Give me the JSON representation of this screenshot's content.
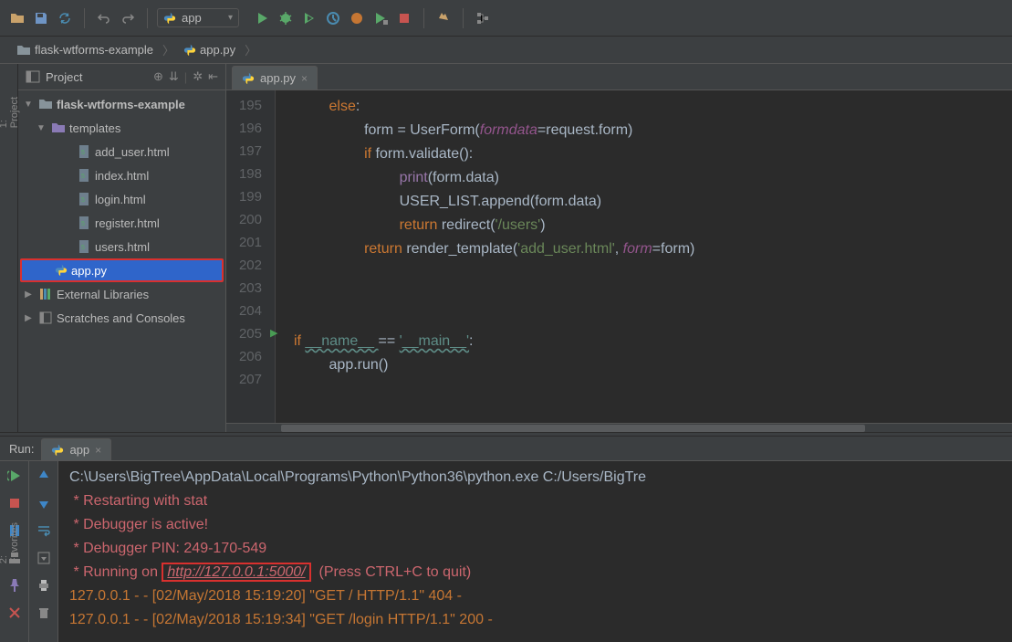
{
  "run_config": {
    "label": "app"
  },
  "breadcrumb": {
    "project": "flask-wtforms-example",
    "file": "app.py"
  },
  "left_tabs": {
    "project": "1: Project",
    "favorites": "2: Favorites"
  },
  "project_panel": {
    "title": "Project",
    "root": "flask-wtforms-example",
    "templates_dir": "templates",
    "files": [
      "add_user.html",
      "index.html",
      "login.html",
      "register.html",
      "users.html"
    ],
    "app_file": "app.py",
    "ext_lib": "External Libraries",
    "scratches": "Scratches and Consoles"
  },
  "editor": {
    "tab": "app.py",
    "lines": [
      "195",
      "196",
      "197",
      "198",
      "199",
      "200",
      "201",
      "202",
      "203",
      "204",
      "205",
      "206",
      "207"
    ]
  },
  "code": {
    "l195a": "else",
    "l195b": ":",
    "l196a": "form ",
    "l196b": "= UserForm(",
    "l196c": "formdata",
    "l196d": "=request.form)",
    "l197a": "if ",
    "l197b": "form.validate():",
    "l198a": "print",
    "l198b": "(form.data)",
    "l199a": "USER_LIST.append(form.data)",
    "l200a": "return ",
    "l200b": "redirect(",
    "l200c": "'/users'",
    "l200d": ")",
    "l201a": "return ",
    "l201b": "render_template(",
    "l201c": "'add_user.html'",
    "l201d": ", ",
    "l201e": "form",
    "l201f": "=form)",
    "l205a": "if ",
    "l205b": "__name__ ",
    "l205c": "== ",
    "l205d": "'__main__'",
    "l205e": ":",
    "l206a": "app.run()"
  },
  "run": {
    "label": "Run:",
    "tab": "app",
    "line1": "C:\\Users\\BigTree\\AppData\\Local\\Programs\\Python\\Python36\\python.exe C:/Users/BigTre",
    "restart": " * Restarting with stat",
    "debug_active": " * Debugger is active!",
    "debug_pin": " * Debugger PIN: 249-170-549",
    "running_pre": " * Running on ",
    "url": "http://127.0.0.1:5000/",
    "running_post": "  (Press CTRL+C to quit)",
    "log1": "127.0.0.1 - - [02/May/2018 15:19:20] \"GET / HTTP/1.1\" 404 -",
    "log2": "127.0.0.1 - - [02/May/2018 15:19:34] \"GET /login HTTP/1.1\" 200 -"
  }
}
